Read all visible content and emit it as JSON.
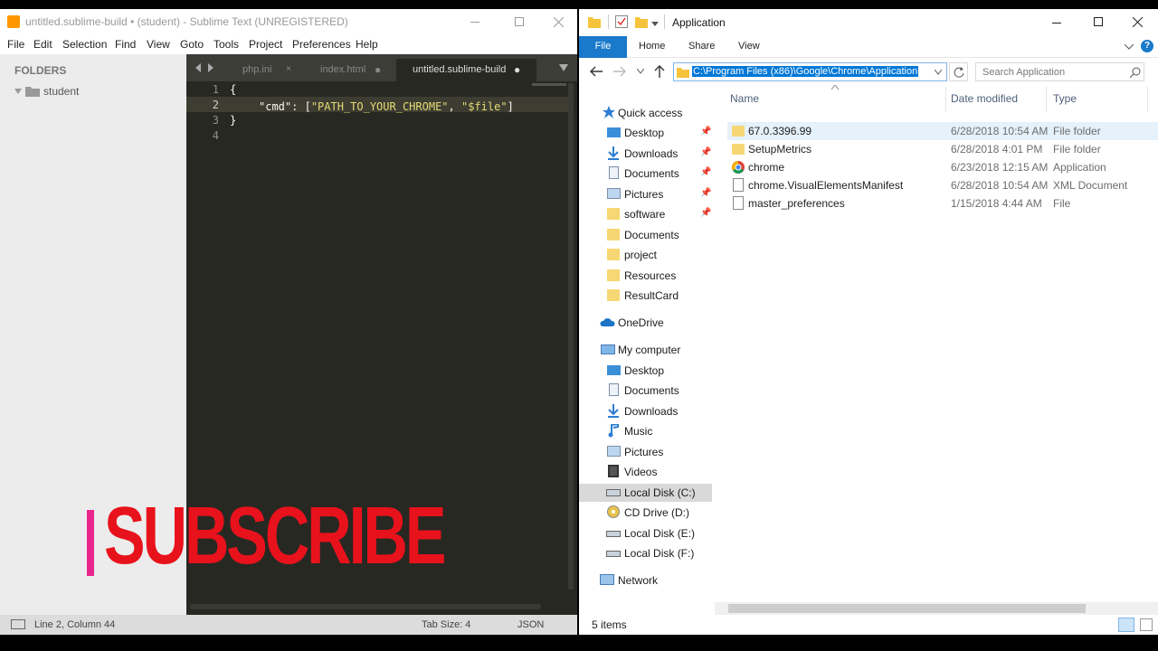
{
  "sublime": {
    "title": "untitled.sublime-build • (student) - Sublime Text (UNREGISTERED)",
    "menu": [
      "File",
      "Edit",
      "Selection",
      "Find",
      "View",
      "Goto",
      "Tools",
      "Project",
      "Preferences",
      "Help"
    ],
    "sidebar": {
      "header": "FOLDERS",
      "folder": "student"
    },
    "tabs": [
      "php.ini",
      "index.html",
      "untitled.sublime-build"
    ],
    "line_numbers": [
      "1",
      "2",
      "3",
      "4"
    ],
    "code": {
      "line1": "{",
      "key": "\"cmd\"",
      "colon": ": [",
      "str1": "\"PATH_TO_YOUR_CHROME\"",
      "comma": ", ",
      "str2": "\"$file\"",
      "close_bracket": "]",
      "line3": "}"
    },
    "status": {
      "position": "Line 2, Column 44",
      "tab_size": "Tab Size: 4",
      "syntax": "JSON"
    }
  },
  "explorer": {
    "title": "Application",
    "ribbon": [
      "File",
      "Home",
      "Share",
      "View"
    ],
    "address": "C:\\Program Files (x86)\\Google\\Chrome\\Application",
    "search_placeholder": "Search Application",
    "nav": {
      "quick_access": "Quick access",
      "quick_items": [
        "Desktop",
        "Downloads",
        "Documents",
        "Pictures",
        "software",
        "Documents",
        "project",
        "Resources",
        "ResultCard"
      ],
      "onedrive": "OneDrive",
      "my_computer": "My computer",
      "pc_items": [
        "Desktop",
        "Documents",
        "Downloads",
        "Music",
        "Pictures",
        "Videos",
        "Local Disk (C:)",
        "CD Drive (D:)",
        "Local Disk (E:)",
        "Local Disk (F:)"
      ],
      "network": "Network"
    },
    "columns": [
      "Name",
      "Date modified",
      "Type"
    ],
    "files": [
      {
        "name": "67.0.3396.99",
        "date": "6/28/2018 10:54 AM",
        "type": "File folder"
      },
      {
        "name": "SetupMetrics",
        "date": "6/28/2018 4:01 PM",
        "type": "File folder"
      },
      {
        "name": "chrome",
        "date": "6/23/2018 12:15 AM",
        "type": "Application"
      },
      {
        "name": "chrome.VisualElementsManifest",
        "date": "6/28/2018 10:54 AM",
        "type": "XML Document"
      },
      {
        "name": "master_preferences",
        "date": "1/15/2018 4:44 AM",
        "type": "File"
      }
    ],
    "status": "5 items"
  },
  "overlay": {
    "text": "SUBSCRIBE"
  },
  "colors": {
    "sublime_bg": "#272822",
    "selection": "#0078d7",
    "subscribe": "#e8121c",
    "accent": "#1979ca"
  }
}
